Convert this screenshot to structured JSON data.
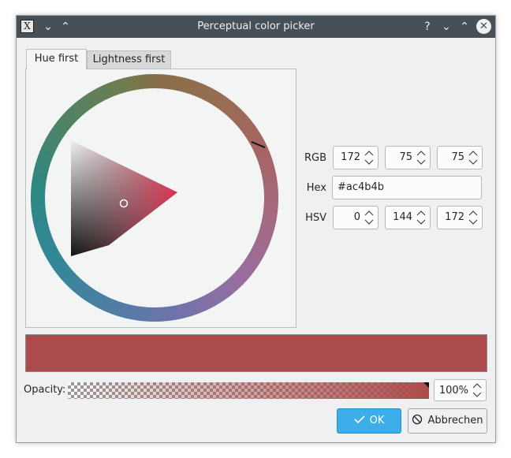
{
  "window": {
    "title": "Perceptual color picker",
    "app_icon_glyph": "X"
  },
  "titlebar_buttons": {
    "minimize_all": "⌄",
    "maximize_all": "⌃",
    "help": "?",
    "minimize": "⌄",
    "maximize": "⌃",
    "close": "✕"
  },
  "tabs": [
    {
      "label": "Hue first",
      "active": true
    },
    {
      "label": "Lightness first",
      "active": false
    }
  ],
  "fields": {
    "rgb_label": "RGB",
    "rgb": [
      "172",
      "75",
      "75"
    ],
    "hex_label": "Hex",
    "hex": "#ac4b4b",
    "hsv_label": "HSV",
    "hsv": [
      "0",
      "144",
      "172"
    ]
  },
  "current_color": "#ac4b4b",
  "opacity": {
    "label": "Opacity:",
    "value": "100%"
  },
  "buttons": {
    "ok": "OK",
    "cancel": "Abbrechen"
  },
  "icons": {
    "ok": "checkmark-icon",
    "cancel": "cancel-icon"
  }
}
